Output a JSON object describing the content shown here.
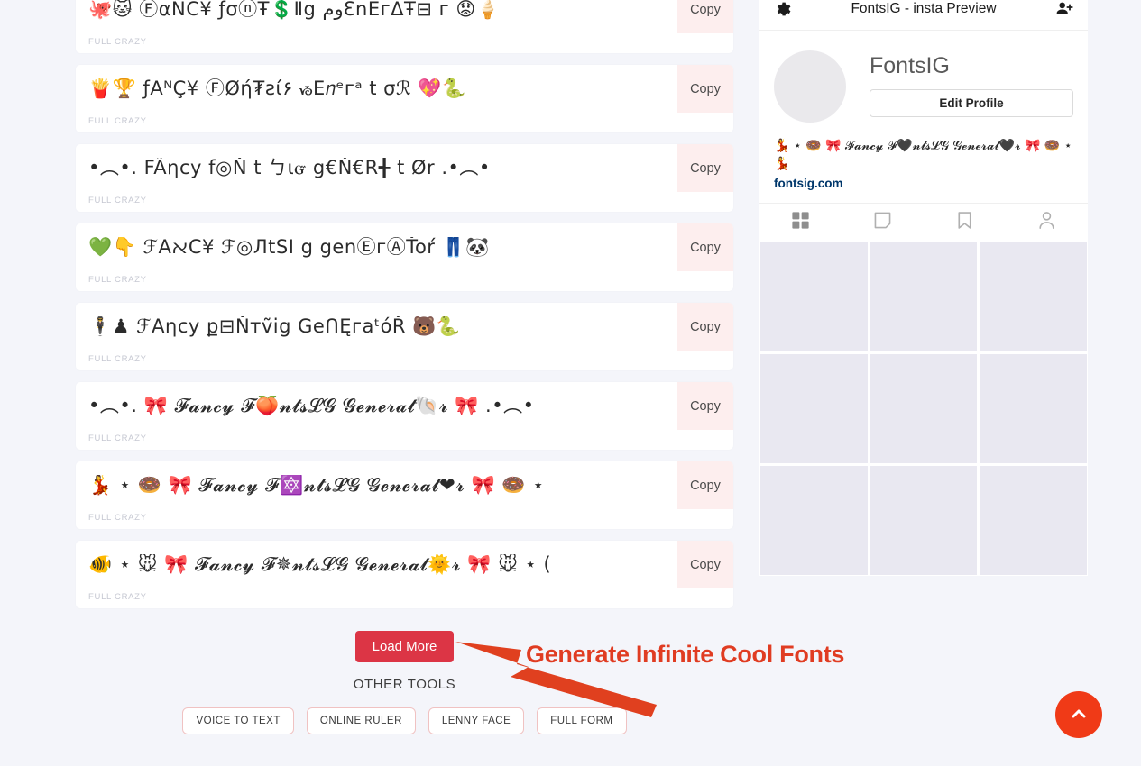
{
  "font_rows": [
    {
      "text": "🐙🐱 ⒻαŇĆ¥ ƒσⓝŦ💲Ⅱg ومƐnEгΔŦ⊟ г  😟🍦",
      "label": "FULL CRAZY",
      "copy_label": "Copy"
    },
    {
      "text": "🍟🏆 ƒAᴺҪ¥ ⒻØή₮ƨί۶ ᏹΕ𝑛ᵉгᵃ t σℛ 💖🐍",
      "label": "FULL CRAZY",
      "copy_label": "Copy"
    },
    {
      "text": "•︵•. FÃηcy f◎Ň t ㄅιᏻ g€Ň€R╉ t Ør .•︵•",
      "label": "FULL CRAZY",
      "copy_label": "Copy"
    },
    {
      "text": "💚👇 ℱAﬡC¥ ℱ◎ЛtSI g  genⒺгⒶŤoŕ 👖🐼",
      "label": "FULL CRAZY",
      "copy_label": "Copy"
    },
    {
      "text": "🕴♟ ℱAηcy ք⊟Ňтṽig GeՈĘгaᵗóŘ 🐻🐍",
      "label": "FULL CRAZY",
      "copy_label": "Copy"
    },
    {
      "text": "•︵•. 🎀 𝓕𝓪𝓷𝓬𝔂 𝓕🍑𝓷𝓽𝓼𝓛𝓖 𝓖𝓮𝓷𝓮𝓻𝓪𝓽🐚𝓻 🎀 .•︵•",
      "label": "FULL CRAZY",
      "copy_label": "Copy"
    },
    {
      "text": "💃 ⋆ 🍩 🎀 𝓕𝓪𝓷𝓬𝔂 𝓕🔯𝓷𝓽𝓼𝓛𝓖 𝓖𝓮𝓷𝓮𝓻𝓪𝓽❤𝓻 🎀 🍩 ⋆",
      "label": "FULL CRAZY",
      "copy_label": "Copy"
    },
    {
      "text": "🐠 ⋆ 🐭 🎀 𝓕𝓪𝓷𝓬𝔂 𝓕✵𝓷𝓽𝓼𝓛𝓖 𝓖𝓮𝓷𝓮𝓻𝓪𝓽🌞𝓻 🎀 🐭 ⋆ (",
      "label": "FULL CRAZY",
      "copy_label": "Copy"
    }
  ],
  "bottom": {
    "load_more_label": "Load More",
    "other_tools_title": "OTHER TOOLS",
    "tools": [
      {
        "label": "VOICE TO TEXT"
      },
      {
        "label": "ONLINE RULER"
      },
      {
        "label": "LENNY FACE"
      },
      {
        "label": "FULL FORM"
      }
    ]
  },
  "annotation": {
    "text": "Generate Infinite Cool Fonts",
    "color": "#e03c22"
  },
  "ig_preview": {
    "header": {
      "title": "FontsIG - insta Preview",
      "settings_icon": "gear-icon",
      "add_person_icon": "add-person-icon"
    },
    "profile": {
      "username": "FontsIG",
      "edit_profile_label": "Edit Profile"
    },
    "bio": {
      "text": "💃 ⋆ 🍩 🎀 𝓕𝓪𝓷𝓬𝔂 𝓕🖤𝓷𝓽𝓼𝓛𝓖 𝓖𝓮𝓷𝓮𝓻𝓪𝓽🖤𝓻 🎀 🍩 ⋆ 💃",
      "link": "fontsig.com"
    },
    "tabs": [
      {
        "icon": "grid-icon",
        "active": true
      },
      {
        "icon": "page-icon",
        "active": false
      },
      {
        "icon": "bookmark-icon",
        "active": false
      },
      {
        "icon": "person-icon",
        "active": false
      }
    ],
    "grid_cells": 9
  },
  "scroll_top": {
    "icon": "chevron-up-icon",
    "color": "#f03a17"
  },
  "colors": {
    "page_background": "#f4f5fa",
    "card_background": "#ffffff",
    "copy_button_background": "#fdeeee",
    "load_more_background": "#dc3545",
    "tool_border": "#f0c2c2",
    "ig_cell": "#e9e8f1",
    "link": "#00376b"
  }
}
